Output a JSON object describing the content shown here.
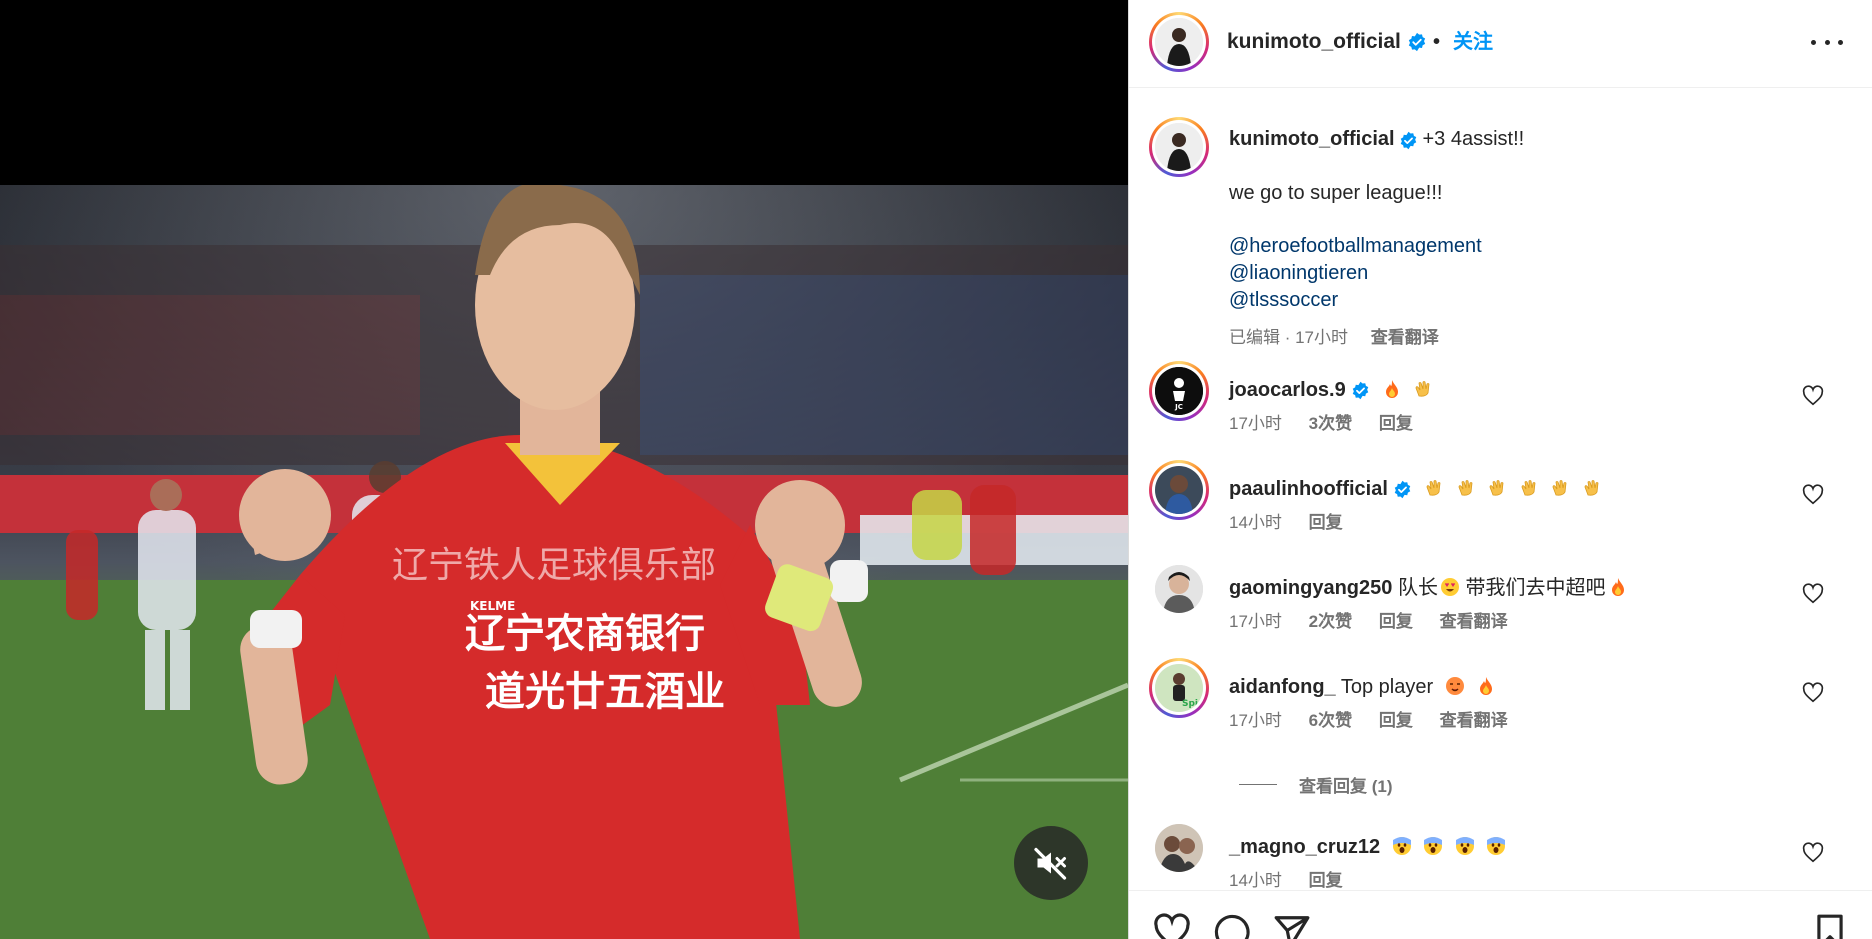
{
  "media": {
    "jersey_club_text": "辽宁铁人足球俱乐部",
    "jersey_sponsor_1": "辽宁农商银行",
    "jersey_sponsor_2": "道光廿五酒业",
    "jersey_brand": "KELME",
    "mute_icon": "speaker-muted-icon"
  },
  "header": {
    "username": "kunimoto_official",
    "separator": "•",
    "follow_label": "关注",
    "more_icon": "more-horizontal-icon"
  },
  "caption": {
    "username": "kunimoto_official",
    "first_line": "+3 4assist!!",
    "second_line": "we go to super league!!!",
    "mentions": [
      "@heroefootballmanagement",
      "@liaoningtieren",
      "@tlsssoccer"
    ],
    "edited_label": "已编辑 · 17小时",
    "translate_label": "查看翻译"
  },
  "comments": [
    {
      "username": "joaocarlos.9",
      "verified": true,
      "text": "",
      "emojis": [
        "fire",
        "clap"
      ],
      "time": "17小时",
      "likes": "3次赞",
      "reply": "回复",
      "translate": ""
    },
    {
      "username": "paaulinhoofficial",
      "verified": true,
      "text": "",
      "emojis": [
        "clap",
        "clap",
        "clap",
        "clap",
        "clap",
        "clap"
      ],
      "time": "14小时",
      "likes": "",
      "reply": "回复",
      "translate": ""
    },
    {
      "username": "gaomingyang250",
      "verified": false,
      "text": "队长",
      "text_after": "带我们去中超吧",
      "emojis": [
        "heart-eyes"
      ],
      "emojis_after": [
        "fire"
      ],
      "time": "17小时",
      "likes": "2次赞",
      "reply": "回复",
      "translate": "查看翻译"
    },
    {
      "username": "aidanfong_",
      "verified": false,
      "text": "Top player",
      "emojis": [
        "hot-face",
        "fire"
      ],
      "time": "17小时",
      "likes": "6次赞",
      "reply": "回复",
      "translate": "查看翻译"
    },
    {
      "username": "_magno_cruz12",
      "verified": false,
      "text": "",
      "emojis": [
        "scream",
        "scream",
        "scream",
        "scream"
      ],
      "time": "14小时",
      "likes": "",
      "reply": "回复",
      "translate": ""
    }
  ],
  "view_replies_label": "查看回复 (1)",
  "action_bar": {
    "icons": [
      "heart-icon",
      "comment-icon",
      "share-icon",
      "bookmark-icon"
    ]
  },
  "colors": {
    "accent": "#0095f6",
    "mention": "#00376b",
    "secondary_text": "#737373",
    "verified": "#0095f6"
  }
}
